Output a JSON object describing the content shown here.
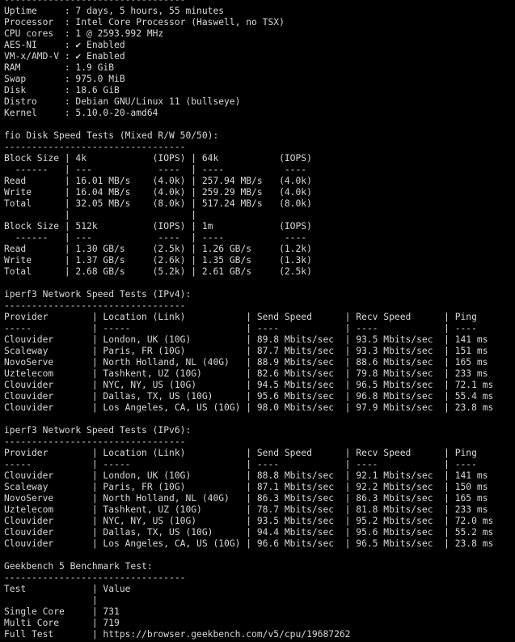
{
  "terminal_lines": [
    "---------------------------------",
    "Uptime     : 7 days, 5 hours, 55 minutes",
    "Processor  : Intel Core Processor (Haswell, no TSX)",
    "CPU cores  : 1 @ 2593.992 MHz",
    "AES-NI     : ✔ Enabled",
    "VM-x/AMD-V : ✔ Enabled",
    "RAM        : 1.9 GiB",
    "Swap       : 975.0 MiB",
    "Disk       : 18.6 GiB",
    "Distro     : Debian GNU/Linux 11 (bullseye)",
    "Kernel     : 5.10.0-20-amd64",
    "",
    "fio Disk Speed Tests (Mixed R/W 50/50):",
    "---------------------------------",
    "Block Size | 4k            (IOPS) | 64k           (IOPS)",
    "  ------   | ---            ----  | ----           ----",
    "Read       | 16.01 MB/s    (4.0k) | 257.94 MB/s   (4.0k)",
    "Write      | 16.04 MB/s    (4.0k) | 259.29 MB/s   (4.0k)",
    "Total      | 32.05 MB/s    (8.0k) | 517.24 MB/s   (8.0k)",
    "           |                      |",
    "Block Size | 512k          (IOPS) | 1m            (IOPS)",
    "  ------   | ---            ----  | ----           ----",
    "Read       | 1.30 GB/s     (2.5k) | 1.26 GB/s     (1.2k)",
    "Write      | 1.37 GB/s     (2.6k) | 1.35 GB/s     (1.3k)",
    "Total      | 2.68 GB/s     (5.2k) | 2.61 GB/s     (2.5k)",
    "",
    "iperf3 Network Speed Tests (IPv4):",
    "---------------------------------",
    "Provider        | Location (Link)           | Send Speed      | Recv Speed      | Ping",
    "-----           | -----                     | ----            | ----            | ----",
    "Clouvider       | London, UK (10G)          | 89.8 Mbits/sec  | 93.5 Mbits/sec  | 141 ms",
    "Scaleway        | Paris, FR (10G)           | 87.7 Mbits/sec  | 93.3 Mbits/sec  | 151 ms",
    "NovoServe       | North Holland, NL (40G)   | 88.9 Mbits/sec  | 88.6 Mbits/sec  | 165 ms",
    "Uztelecom       | Tashkent, UZ (10G)        | 82.6 Mbits/sec  | 79.8 Mbits/sec  | 233 ms",
    "Clouvider       | NYC, NY, US (10G)         | 94.5 Mbits/sec  | 96.5 Mbits/sec  | 72.1 ms",
    "Clouvider       | Dallas, TX, US (10G)      | 95.6 Mbits/sec  | 96.8 Mbits/sec  | 55.4 ms",
    "Clouvider       | Los Angeles, CA, US (10G) | 98.0 Mbits/sec  | 97.9 Mbits/sec  | 23.8 ms",
    "",
    "iperf3 Network Speed Tests (IPv6):",
    "---------------------------------",
    "Provider        | Location (Link)           | Send Speed      | Recv Speed      | Ping",
    "-----           | -----                     | ----            | ----            | ----",
    "Clouvider       | London, UK (10G)          | 88.8 Mbits/sec  | 92.1 Mbits/sec  | 141 ms",
    "Scaleway        | Paris, FR (10G)           | 87.1 Mbits/sec  | 92.2 Mbits/sec  | 150 ms",
    "NovoServe       | North Holland, NL (40G)   | 86.3 Mbits/sec  | 86.3 Mbits/sec  | 165 ms",
    "Uztelecom       | Tashkent, UZ (10G)        | 78.7 Mbits/sec  | 81.8 Mbits/sec  | 233 ms",
    "Clouvider       | NYC, NY, US (10G)         | 93.5 Mbits/sec  | 95.2 Mbits/sec  | 72.0 ms",
    "Clouvider       | Dallas, TX, US (10G)      | 94.4 Mbits/sec  | 95.6 Mbits/sec  | 55.2 ms",
    "Clouvider       | Los Angeles, CA, US (10G) | 96.6 Mbits/sec  | 96.5 Mbits/sec  | 23.8 ms",
    "",
    "Geekbench 5 Benchmark Test:",
    "---------------------------------",
    "Test            | Value",
    "                |",
    "Single Core     | 731",
    "Multi Core      | 719",
    "Full Test       | https://browser.geekbench.com/v5/cpu/19687262"
  ],
  "colors": {
    "background": "#000000",
    "foreground": "#d8d8d8"
  }
}
